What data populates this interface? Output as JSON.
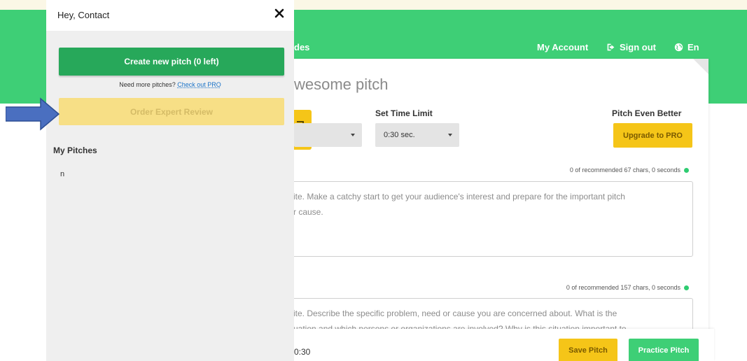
{
  "header": {
    "nav_partial": "des",
    "my_account": "My Account",
    "sign_out": "Sign out",
    "language": "En"
  },
  "editor": {
    "title_partial": "wesome pitch",
    "tile_text_partial": "es",
    "left_dropdown_value": "",
    "time_limit_label": "Set Time Limit",
    "time_limit_value": "0:30 sec.",
    "pitch_better_label": "Pitch Even Better",
    "upgrade_label": "Upgrade to PRO",
    "counter_1": "0 of recommended 67 chars, 0 seconds",
    "counter_2": "0 of recommended 157 chars, 0 seconds",
    "textbox_1": "ite. Make a catchy start to get your audience's interest and prepare for the important pitch\nr cause.",
    "textbox_2": "ite. Describe the specific problem, need or cause you are concerned about. What is the\nuation and which persons or organizations are involved? Why is this situation important to"
  },
  "footer_bar": {
    "timer_partial": "0:30",
    "save_label": "Save Pitch",
    "practice_label": "Practice Pitch"
  },
  "sidebar": {
    "greeting": "Hey, Contact",
    "create_label": "Create new pitch (0 left)",
    "need_more_text": "Need more pitches?",
    "check_out_pro": "Check out PRO",
    "order_review_label": "Order Expert Review",
    "my_pitches_heading": "My Pitches",
    "pitches": [
      "n"
    ]
  },
  "colors": {
    "brand_green": "#3ecf76",
    "button_green": "#27a85a",
    "accent_yellow": "#f5c518",
    "disabled_yellow": "#f7df86",
    "arrow_blue": "#4a6fc0"
  },
  "icons": {
    "close": "close-icon",
    "sign_out": "sign-out-icon",
    "language": "globe-icon",
    "annotation": "arrow-right-icon"
  }
}
